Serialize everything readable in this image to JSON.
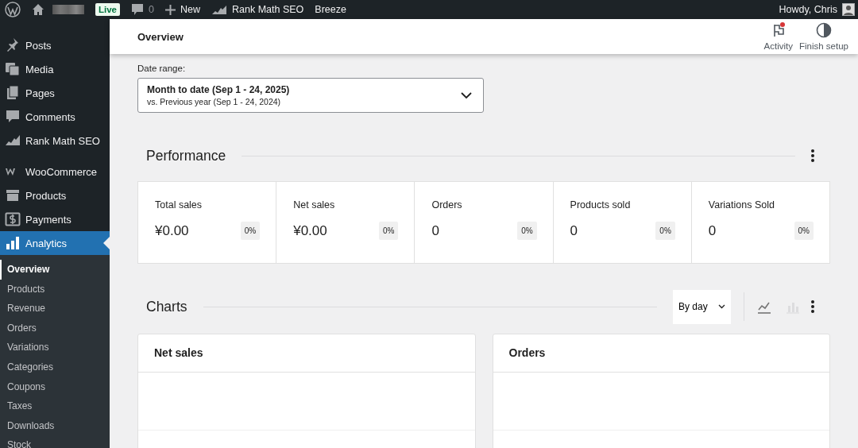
{
  "admin_bar": {
    "live_badge": "Live",
    "comments_count": "0",
    "new_label": "New",
    "items": [
      "Rank Math SEO",
      "Breeze"
    ],
    "greeting": "Howdy, Chris"
  },
  "sidebar": {
    "items": [
      {
        "label": "Posts",
        "selected": false
      },
      {
        "label": "Media",
        "selected": false
      },
      {
        "label": "Pages",
        "selected": false
      },
      {
        "label": "Comments",
        "selected": false
      },
      {
        "label": "Rank Math SEO",
        "selected": false
      },
      {
        "label": "WooCommerce",
        "selected": false
      },
      {
        "label": "Products",
        "selected": false
      },
      {
        "label": "Payments",
        "selected": false
      },
      {
        "label": "Analytics",
        "selected": true,
        "children": [
          {
            "label": "Overview",
            "selected": true
          },
          {
            "label": "Products",
            "selected": false
          },
          {
            "label": "Revenue",
            "selected": false
          },
          {
            "label": "Orders",
            "selected": false
          },
          {
            "label": "Variations",
            "selected": false
          },
          {
            "label": "Categories",
            "selected": false
          },
          {
            "label": "Coupons",
            "selected": false
          },
          {
            "label": "Taxes",
            "selected": false
          },
          {
            "label": "Downloads",
            "selected": false
          },
          {
            "label": "Stock",
            "selected": false
          }
        ]
      }
    ]
  },
  "header": {
    "title": "Overview",
    "actions": [
      {
        "label": "Activity",
        "unread": true
      },
      {
        "label": "Finish setup",
        "unread": false
      }
    ]
  },
  "date_range": {
    "label": "Date range:",
    "value": "Month to date (Sep 1 - 24, 2025)",
    "comparison": "vs. Previous year (Sep 1 - 24, 2024)"
  },
  "performance": {
    "title": "Performance",
    "metrics": [
      {
        "label": "Total sales",
        "value": "¥0.00",
        "change": "0%"
      },
      {
        "label": "Net sales",
        "value": "¥0.00",
        "change": "0%"
      },
      {
        "label": "Orders",
        "value": "0",
        "change": "0%"
      },
      {
        "label": "Products sold",
        "value": "0",
        "change": "0%"
      },
      {
        "label": "Variations Sold",
        "value": "0",
        "change": "0%"
      }
    ]
  },
  "charts": {
    "title": "Charts",
    "interval": "By day",
    "views": [
      {
        "kind": "line",
        "selected": true
      },
      {
        "kind": "bar",
        "selected": false
      }
    ],
    "panels": [
      {
        "title": "Net sales"
      },
      {
        "title": "Orders"
      }
    ]
  }
}
